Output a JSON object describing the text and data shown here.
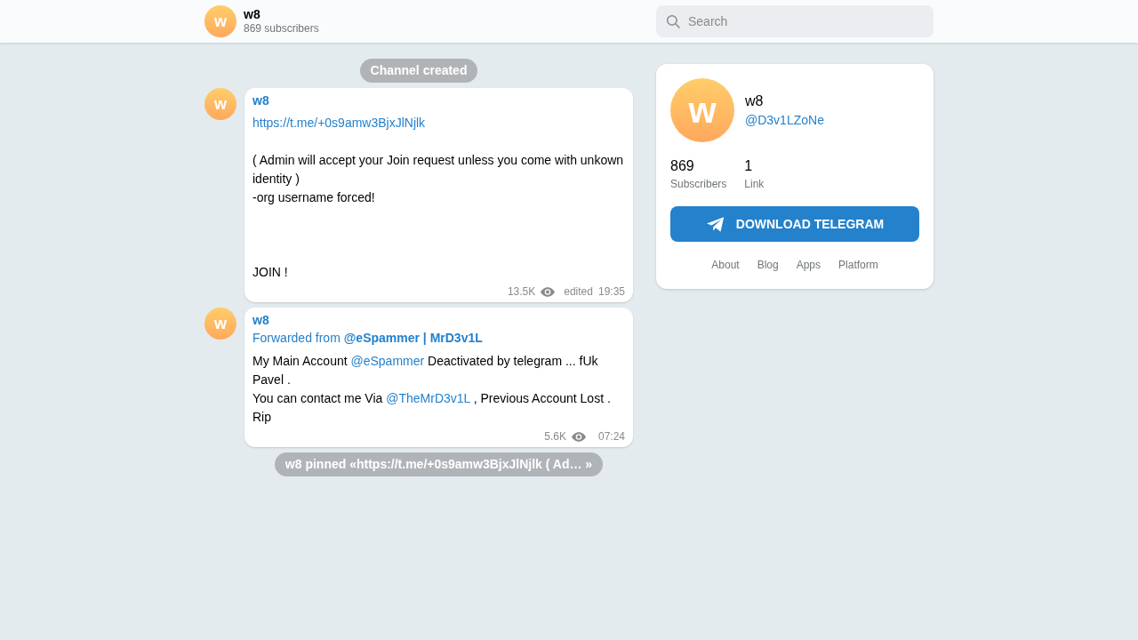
{
  "header": {
    "avatar_letter": "w",
    "title": "w8",
    "subtitle": "869 subscribers",
    "search": {
      "placeholder": "Search"
    }
  },
  "messages": [
    {
      "kind": "service",
      "text": "Channel created"
    },
    {
      "kind": "post",
      "avatar_letter": "w",
      "author": "w8",
      "lines": [
        {
          "kind": "text",
          "segments": [
            {
              "kind": "link",
              "text": "https://t.me/+0s9amw3BjxJlNjlk"
            }
          ]
        },
        {
          "kind": "blank"
        },
        {
          "kind": "text",
          "segments": [
            {
              "kind": "plain",
              "text": "( Admin will accept your Join request unless you come with unkown identity )"
            }
          ]
        },
        {
          "kind": "text",
          "segments": [
            {
              "kind": "plain",
              "text": "-org username forced!"
            }
          ]
        },
        {
          "kind": "blank"
        },
        {
          "kind": "blank"
        },
        {
          "kind": "blank"
        },
        {
          "kind": "text",
          "segments": [
            {
              "kind": "plain",
              "text": "JOIN !"
            }
          ]
        }
      ],
      "views": "13.5K",
      "edited": "edited",
      "time": "19:35"
    },
    {
      "kind": "post",
      "avatar_letter": "w",
      "author": "w8",
      "forwarded": "Forwarded from **@eSpammer | MrD3v1L**",
      "lines": [
        {
          "kind": "text",
          "segments": [
            {
              "kind": "plain",
              "text": "My Main Account "
            },
            {
              "kind": "link",
              "text": "@eSpammer"
            },
            {
              "kind": "plain",
              "text": " Deactivated by telegram ... fUk Pavel ."
            }
          ]
        },
        {
          "kind": "text",
          "segments": [
            {
              "kind": "plain",
              "text": "You can contact me Via "
            },
            {
              "kind": "link",
              "text": "@TheMrD3v1L"
            },
            {
              "kind": "plain",
              "text": " , Previous Account Lost . Rip"
            }
          ]
        }
      ],
      "views": "5.6K",
      "time": "07:24"
    },
    {
      "kind": "service",
      "text": "w8 pinned «https://t.me/+0s9amw3BjxJlNjlk ( Ad… »"
    }
  ],
  "profile": {
    "avatar_letter": "w",
    "name": "w8",
    "username": "@D3v1LZoNe",
    "stats": [
      {
        "value": "869",
        "label": "Subscribers"
      },
      {
        "value": "1",
        "label": "Link"
      }
    ],
    "download_button": "DOWNLOAD TELEGRAM",
    "links": [
      "About",
      "Blog",
      "Apps",
      "Platform"
    ]
  }
}
